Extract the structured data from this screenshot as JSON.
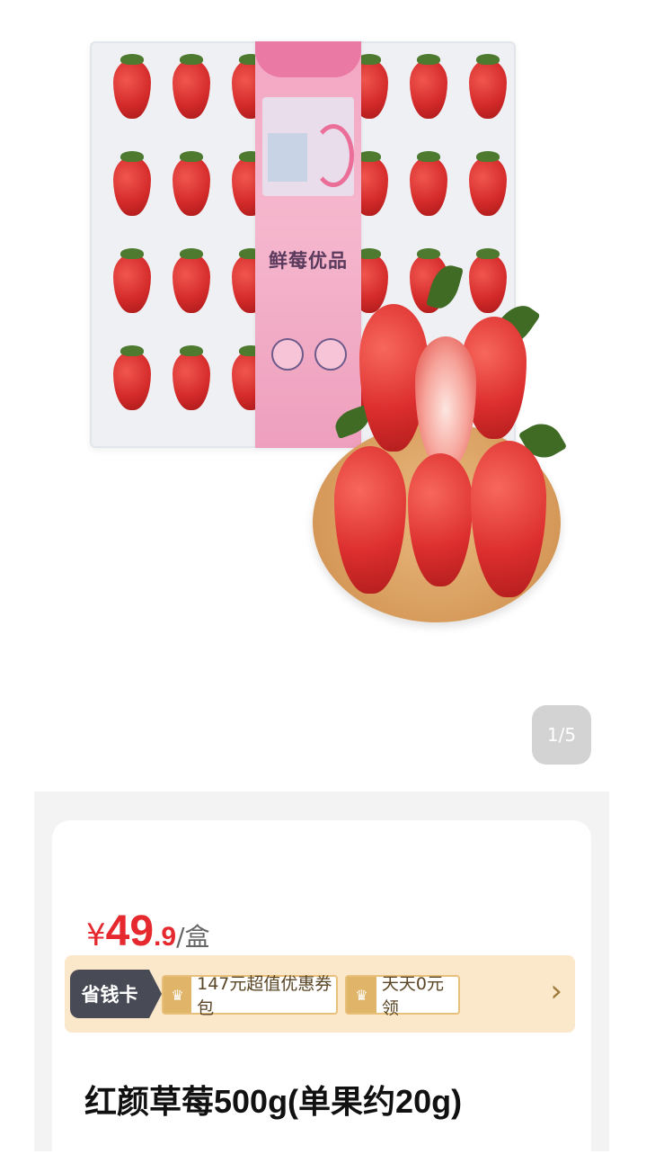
{
  "hero": {
    "package_brand_text": "鲜莓优品",
    "icon": "product-photo"
  },
  "pager": {
    "text": "1/5"
  },
  "product": {
    "currency": "¥",
    "price_integer": "49",
    "price_decimal": ".9",
    "price_unit": "/盒",
    "title": "红颜草莓500g(单果约20g)"
  },
  "savings": {
    "label": "省钱卡",
    "coupons": [
      {
        "text": "147元超值优惠券包",
        "icon": "crown-icon"
      },
      {
        "text": "天天0元领",
        "icon": "crown-icon"
      }
    ],
    "more_icon": "chevron-right-icon"
  },
  "colors": {
    "price": "#e5292f",
    "save_label_bg": "#484b55",
    "save_bar_bg": "#fbe8cb",
    "coupon_border": "#e9c07a"
  }
}
